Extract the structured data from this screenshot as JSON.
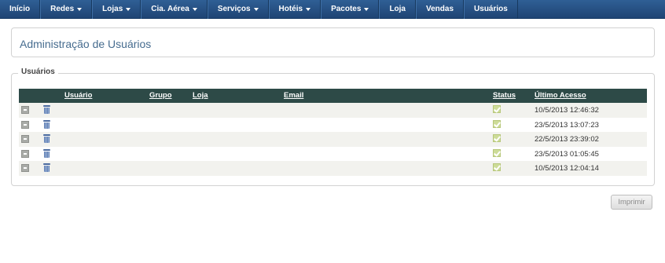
{
  "nav": {
    "items": [
      {
        "label": "Início",
        "dropdown": false
      },
      {
        "label": "Redes",
        "dropdown": true
      },
      {
        "label": "Lojas",
        "dropdown": true
      },
      {
        "label": "Cia. Aérea",
        "dropdown": true
      },
      {
        "label": "Serviços",
        "dropdown": true
      },
      {
        "label": "Hotéis",
        "dropdown": true
      },
      {
        "label": "Pacotes",
        "dropdown": true
      },
      {
        "label": "Loja",
        "dropdown": false
      },
      {
        "label": "Vendas",
        "dropdown": false
      },
      {
        "label": "Usuários",
        "dropdown": false
      }
    ]
  },
  "page": {
    "title": "Administração de Usuários"
  },
  "users_section": {
    "legend": "Usuários",
    "columns": {
      "usuario": "Usuário",
      "grupo": "Grupo",
      "loja": "Loja",
      "email": "Email",
      "status": "Status",
      "ultimo_acesso": "Último Acesso"
    },
    "rows": [
      {
        "last_access": "10/5/2013 12:46:32",
        "status": "active"
      },
      {
        "last_access": "23/5/2013 13:07:23",
        "status": "active"
      },
      {
        "last_access": "22/5/2013 23:39:02",
        "status": "active"
      },
      {
        "last_access": "23/5/2013 01:05:45",
        "status": "active"
      },
      {
        "last_access": "10/5/2013 12:04:14",
        "status": "active"
      }
    ]
  },
  "actions": {
    "print_label": "Imprimir"
  },
  "colors": {
    "navbar": "#1f4474",
    "table_header": "#2d4a47",
    "status_ok": "#cddc98",
    "title_text": "#466c8f"
  }
}
